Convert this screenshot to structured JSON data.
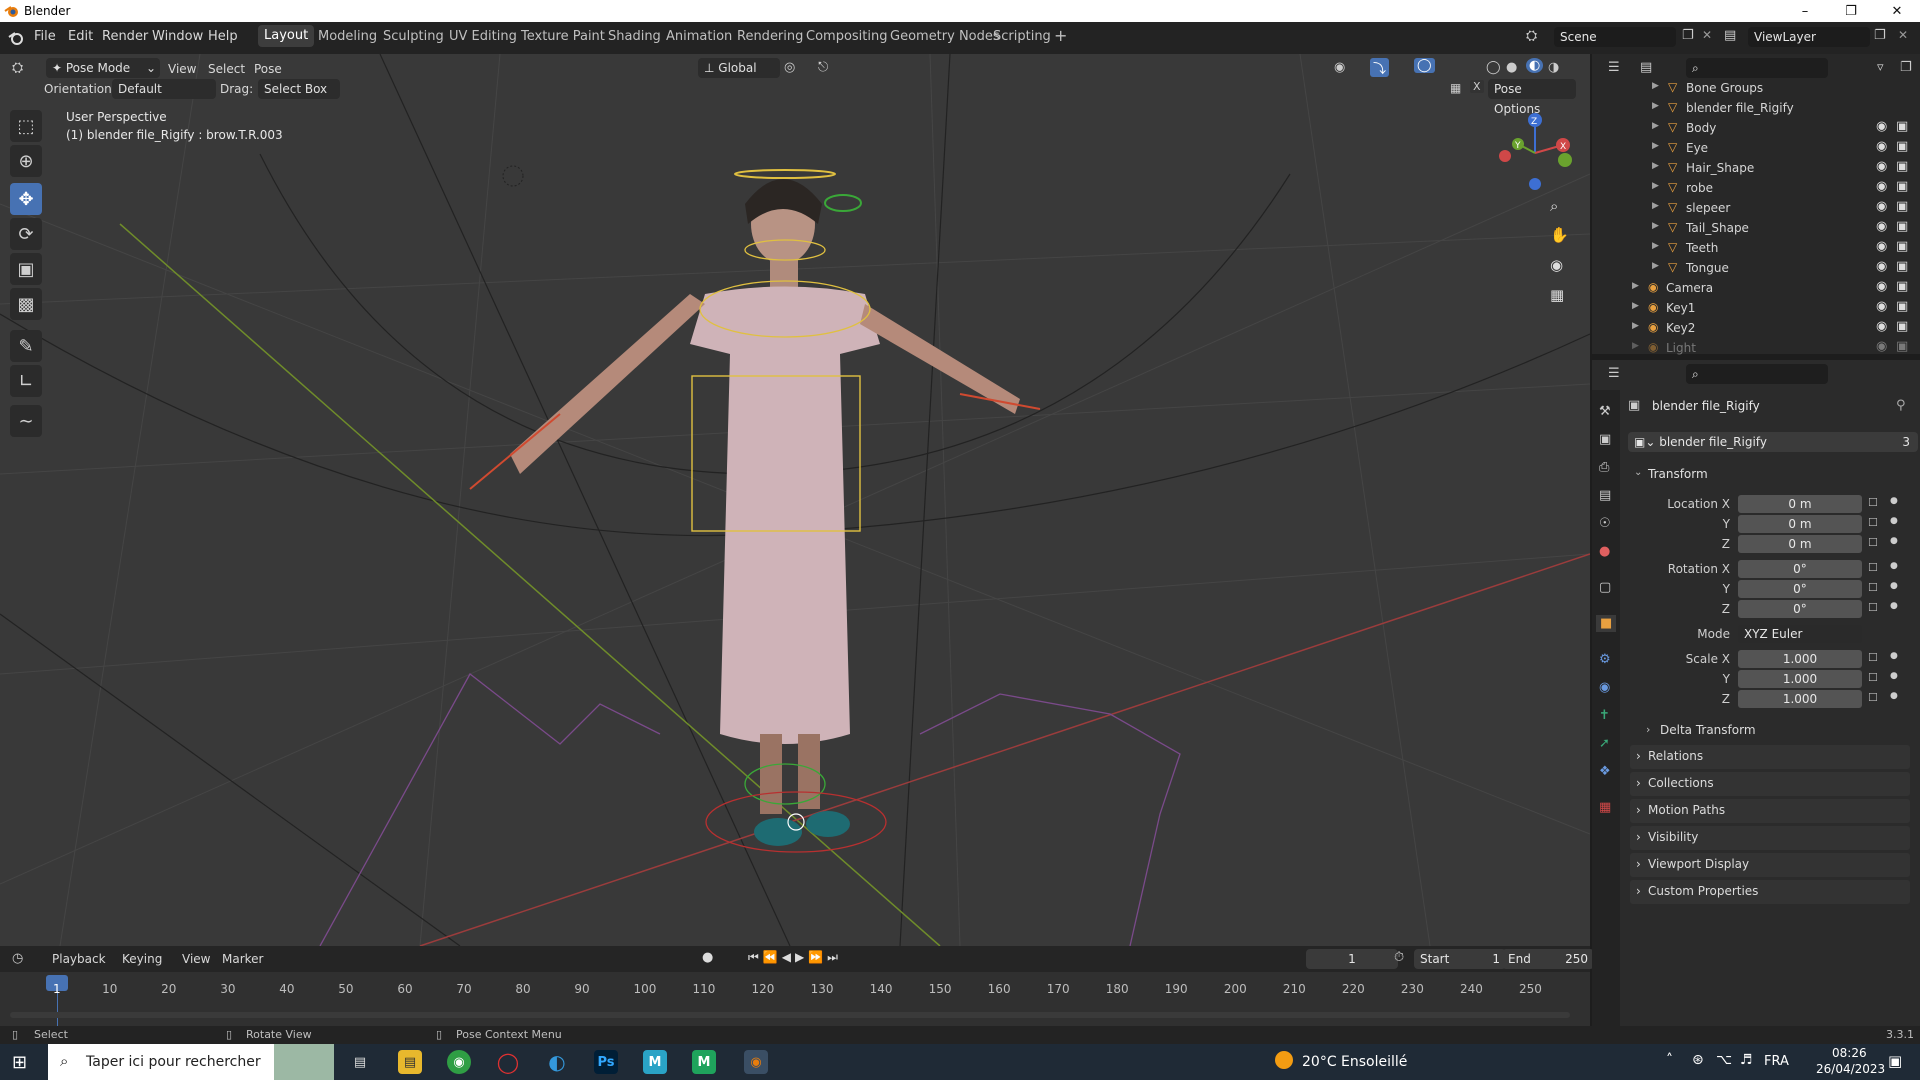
{
  "window": {
    "title": "Blender"
  },
  "menu": [
    "File",
    "Edit",
    "Render",
    "Window",
    "Help"
  ],
  "workspaces": [
    "Layout",
    "Modeling",
    "Sculpting",
    "UV Editing",
    "Texture Paint",
    "Shading",
    "Animation",
    "Rendering",
    "Compositing",
    "Geometry Nodes",
    "Scripting"
  ],
  "scene": {
    "label": "Scene",
    "view_layer": "ViewLayer"
  },
  "viewport_header": {
    "mode": "Pose Mode",
    "menus": [
      "View",
      "Select",
      "Pose"
    ],
    "transform_orientation": "Global",
    "orientation_label": "Orientation:",
    "orientation_value": "Default",
    "drag_label": "Drag:",
    "drag_value": "Select Box",
    "pose_options": "Pose Options"
  },
  "viewport_overlay": {
    "perspective": "User Perspective",
    "active": "(1) blender file_Rigify : brow.T.R.003"
  },
  "gizmo_axes": {
    "x": "X",
    "y": "Y",
    "z": "Z"
  },
  "outliner": {
    "rows": [
      {
        "label": "Bone Groups",
        "depth": 2
      },
      {
        "label": "blender file_Rigify",
        "depth": 2
      },
      {
        "label": "Body",
        "depth": 2
      },
      {
        "label": "Eye",
        "depth": 2
      },
      {
        "label": "Hair_Shape",
        "depth": 2
      },
      {
        "label": "robe",
        "depth": 2
      },
      {
        "label": "slepeer",
        "depth": 2
      },
      {
        "label": "Tail_Shape",
        "depth": 2
      },
      {
        "label": "Teeth",
        "depth": 2
      },
      {
        "label": "Tongue",
        "depth": 2
      },
      {
        "label": "Camera",
        "depth": 1
      },
      {
        "label": "Key1",
        "depth": 1
      },
      {
        "label": "Key2",
        "depth": 1
      },
      {
        "label": "Light",
        "depth": 1
      }
    ]
  },
  "properties": {
    "object_name": "blender file_Rigify",
    "data_name": "blender file_Rigify",
    "users": "3",
    "transform_header": "Transform",
    "location": {
      "label": "Location X",
      "y": "Y",
      "z": "Z",
      "values": [
        "0 m",
        "0 m",
        "0 m"
      ]
    },
    "rotation": {
      "label": "Rotation X",
      "y": "Y",
      "z": "Z",
      "values": [
        "0°",
        "0°",
        "0°"
      ]
    },
    "mode": {
      "label": "Mode",
      "value": "XYZ Euler"
    },
    "scale": {
      "label": "Scale X",
      "y": "Y",
      "z": "Z",
      "values": [
        "1.000",
        "1.000",
        "1.000"
      ]
    },
    "delta": "Delta Transform",
    "panels": [
      "Relations",
      "Collections",
      "Motion Paths",
      "Visibility",
      "Viewport Display",
      "Custom Properties"
    ]
  },
  "timeline": {
    "menus": [
      "Playback",
      "Keying",
      "View",
      "Marker"
    ],
    "current_frame": "1",
    "start_label": "Start",
    "start": "1",
    "end_label": "End",
    "end": "250",
    "ticks": [
      "1",
      "10",
      "20",
      "30",
      "40",
      "50",
      "60",
      "70",
      "80",
      "90",
      "100",
      "110",
      "120",
      "130",
      "140",
      "150",
      "160",
      "170",
      "180",
      "190",
      "200",
      "210",
      "220",
      "230",
      "240",
      "250"
    ]
  },
  "statusbar": {
    "select": "Select",
    "rotate": "Rotate View",
    "context": "Pose Context Menu",
    "version": "3.3.1"
  },
  "taskbar": {
    "search_placeholder": "Taper ici pour rechercher",
    "weather": "20°C  Ensoleillé",
    "lang": "FRA",
    "time": "08:26",
    "date": "26/04/2023"
  }
}
